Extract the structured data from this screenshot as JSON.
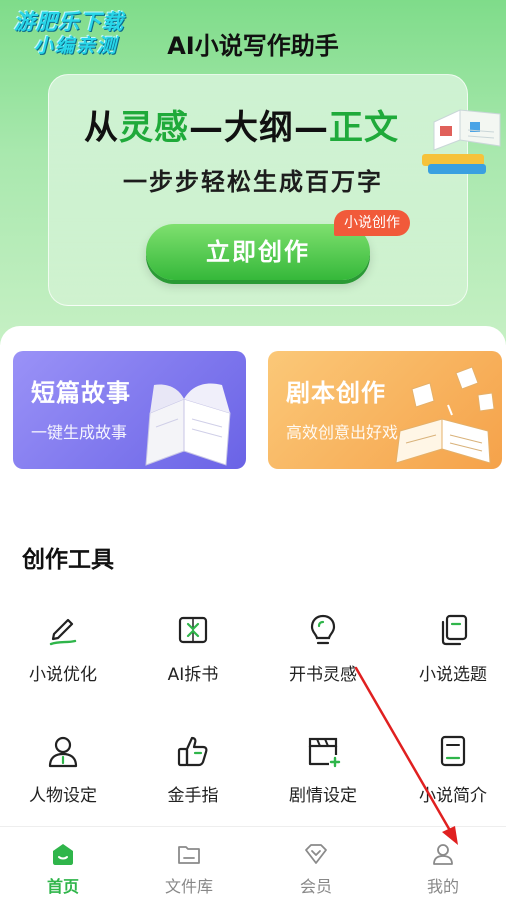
{
  "watermark": {
    "line1": "游肥乐下载",
    "line2": "小编亲测"
  },
  "app": {
    "title": "AI小说写作助手"
  },
  "banner": {
    "headline_parts": [
      "从",
      "灵感",
      "—",
      "大纲",
      "—",
      "正文"
    ],
    "subtitle": "一步步轻松生成百万字",
    "button_label": "立即创作",
    "badge": "小说创作"
  },
  "features": [
    {
      "title": "短篇故事",
      "subtitle": "一键生成故事",
      "icon": "open-book-icon"
    },
    {
      "title": "剧本创作",
      "subtitle": "高效创意出好戏",
      "icon": "script-book-icon"
    }
  ],
  "tools_section": {
    "title": "创作工具"
  },
  "tools": [
    {
      "label": "小说优化",
      "icon": "pen-icon"
    },
    {
      "label": "AI拆书",
      "icon": "split-book-icon"
    },
    {
      "label": "开书灵感",
      "icon": "lightbulb-icon"
    },
    {
      "label": "小说选题",
      "icon": "copy-doc-icon"
    },
    {
      "label": "人物设定",
      "icon": "person-icon"
    },
    {
      "label": "金手指",
      "icon": "thumbs-up-icon"
    },
    {
      "label": "剧情设定",
      "icon": "clapperboard-icon"
    },
    {
      "label": "小说简介",
      "icon": "doc-summary-icon"
    }
  ],
  "nav": {
    "items": [
      {
        "label": "首页",
        "icon": "home-icon",
        "active": true
      },
      {
        "label": "文件库",
        "icon": "folder-icon",
        "active": false
      },
      {
        "label": "会员",
        "icon": "vip-diamond-icon",
        "active": false
      },
      {
        "label": "我的",
        "icon": "profile-icon",
        "active": false
      }
    ]
  },
  "colors": {
    "brand_green": "#2fb54a",
    "annotation_red": "#e02020",
    "story_purple": "#7b73ee",
    "script_orange": "#f7ac55"
  }
}
